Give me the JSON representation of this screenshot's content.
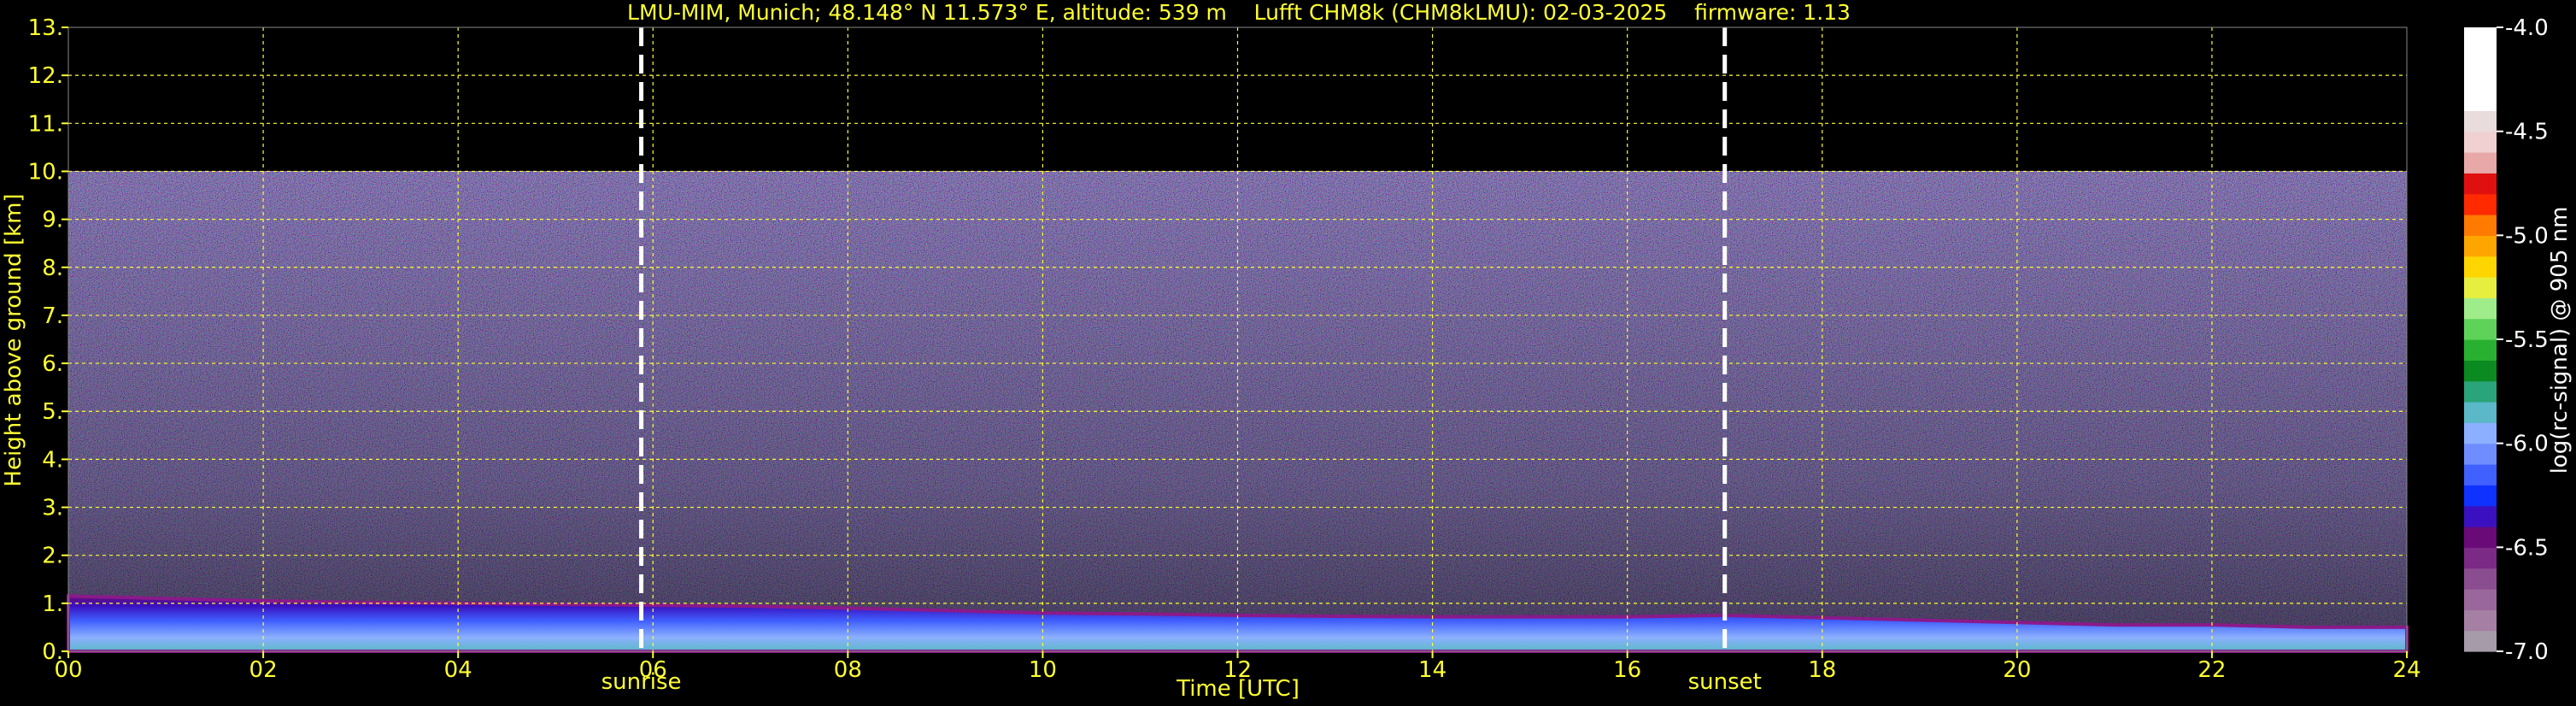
{
  "chart_data": {
    "type": "heatmap",
    "title": "LMU-MIM, Munich; 48.148° N 11.573° E, altitude: 539 m    Lufft CHM8k (CHM8kLMU): 02-03-2025    firmware: 1.13",
    "xlabel": "Time [UTC]",
    "ylabel": "Height above ground [km]",
    "xlim": [
      0,
      24
    ],
    "ylim": [
      0,
      13
    ],
    "x_ticks": [
      "00",
      "02",
      "04",
      "06",
      "08",
      "10",
      "12",
      "14",
      "16",
      "18",
      "20",
      "22",
      "24"
    ],
    "y_ticks": [
      "0.",
      "1.",
      "2.",
      "3.",
      "4.",
      "5.",
      "6.",
      "7.",
      "8.",
      "9.",
      "10.",
      "11.",
      "12.",
      "13."
    ],
    "grid": true,
    "grid_color": "#ffff33",
    "markers": [
      {
        "label": "sunrise",
        "time": 5.88
      },
      {
        "label": "sunset",
        "time": 17.0
      }
    ],
    "signal_top_km": 10.0,
    "boundary_layer_top_km": [
      1.15,
      1.1,
      1.05,
      1.02,
      1.0,
      0.98,
      0.96,
      0.94,
      0.9,
      0.85,
      0.8,
      0.78,
      0.75,
      0.73,
      0.72,
      0.72,
      0.72,
      0.75,
      0.7,
      0.65,
      0.6,
      0.55,
      0.55,
      0.5,
      0.5
    ],
    "colorbar": {
      "label": "log(rc-signal) @ 905 nm",
      "range": [
        -7.0,
        -4.0
      ],
      "ticks": [
        "-4.0",
        "-4.5",
        "-5.0",
        "-5.5",
        "-6.0",
        "-6.5",
        "-7.0"
      ],
      "colors": [
        "#a69ba9",
        "#a67fa4",
        "#9a679c",
        "#8a4d90",
        "#7b2a86",
        "#6a0a78",
        "#3a10c0",
        "#1032ff",
        "#4060ff",
        "#6f8dff",
        "#8cb0ff",
        "#5ab8c8",
        "#2aa47a",
        "#0a8a20",
        "#2ab030",
        "#5fd25a",
        "#9fec8a",
        "#e6ee40",
        "#ffd500",
        "#ffa500",
        "#ff7a00",
        "#ff2a00",
        "#e01010",
        "#e8a8a8",
        "#f0d0d0",
        "#e8dcdc",
        "#ffffff",
        "#ffffff",
        "#ffffff",
        "#ffffff"
      ]
    }
  }
}
